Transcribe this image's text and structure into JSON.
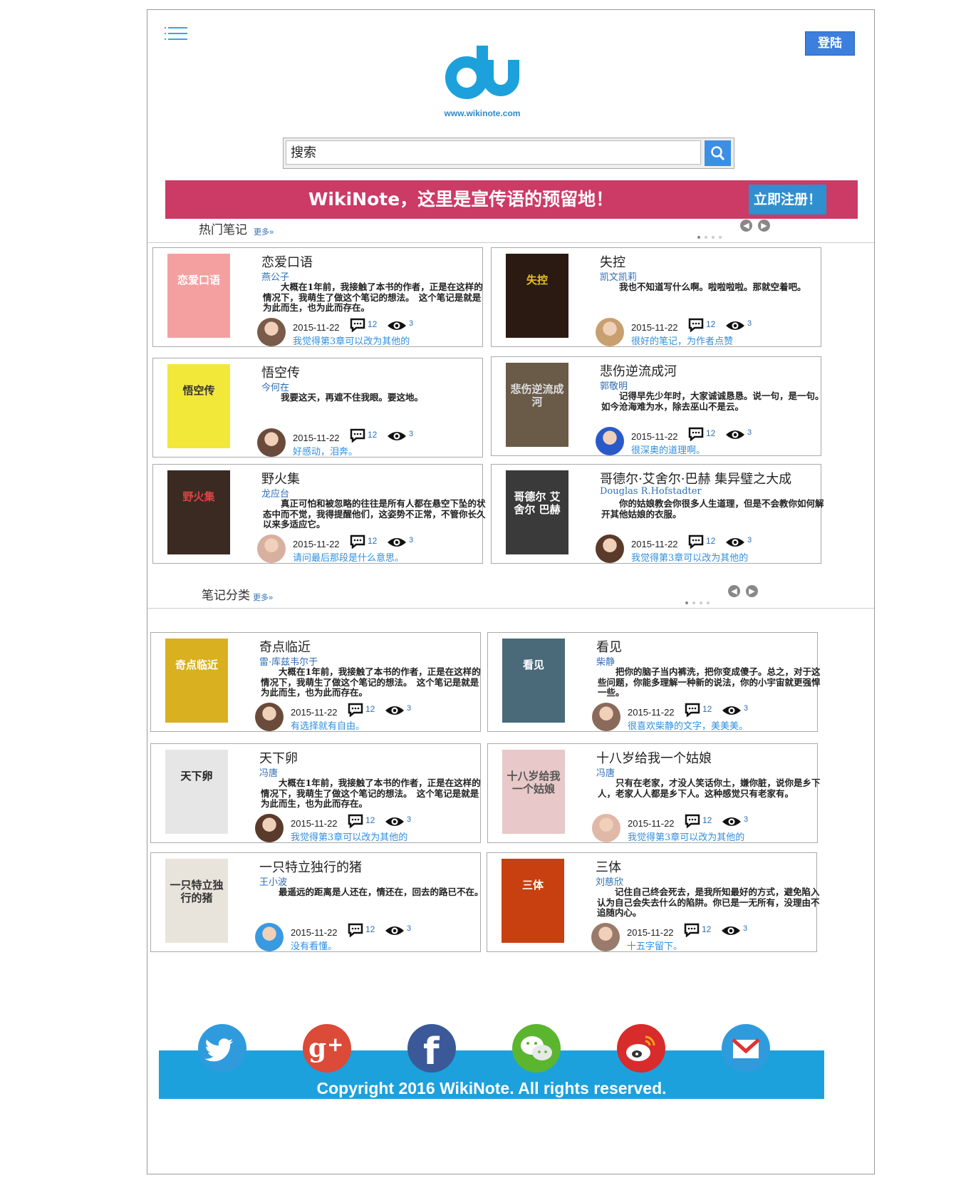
{
  "header": {
    "logo_url": "www.wikinote.com",
    "login_label": "登陆"
  },
  "search": {
    "placeholder": "搜索"
  },
  "banner": {
    "text": "WikiNote，这里是宣传语的预留地！",
    "button_label": "立即注册！"
  },
  "hot_notes": {
    "title": "热门笔记",
    "more": "更多»",
    "cards": [
      {
        "title": "恋爱口语",
        "author": "燕公子",
        "desc": "大概在1年前，我接触了本书的作者，正是在这样的情况下，我萌生了做这个笔记的想法。　这个笔记是就是为此而生，也为此而存在。",
        "date": "2015-11-22",
        "comments": "12",
        "views": "3",
        "comment": "我觉得第3章可以改为其他的"
      },
      {
        "title": "失控",
        "author": "凯文凯莉",
        "desc": "我也不知道写什么啊。啦啦啦啦。那就空着吧。",
        "date": "2015-11-22",
        "comments": "12",
        "views": "3",
        "comment": "很好的笔记，为作者点赞"
      },
      {
        "title": "悟空传",
        "author": "今何在",
        "desc": "我要这天，再遮不住我眼。要这地。",
        "date": "2015-11-22",
        "comments": "12",
        "views": "3",
        "comment": "好感动，泪奔。"
      },
      {
        "title": "悲伤逆流成河",
        "author": "郭敬明",
        "desc": "记得早先少年时，大家诚诚恳恳。说一句，是一句。如今沧海难为水，除去巫山不是云。",
        "date": "2015-11-22",
        "comments": "12",
        "views": "3",
        "comment": "很深奥的道理啊。"
      },
      {
        "title": "野火集",
        "author": "龙应台",
        "desc": "真正可怕和被忽略的往往是所有人都在悬空下坠的状态中而不觉，我得提醒他们，这姿势不正常，不管你长久以来多适应它。",
        "date": "2015-11-22",
        "comments": "12",
        "views": "3",
        "comment": "请问最后那段是什么意思。"
      },
      {
        "title": "哥德尔·艾舍尔·巴赫 集异璧之大成",
        "author": "Douglas R.Hofstadter",
        "desc": "你的姑娘教会你很多人生道理，但是不会教你如何解开其他姑娘的衣服。",
        "date": "2015-11-22",
        "comments": "12",
        "views": "3",
        "comment": "我觉得第3章可以改为其他的"
      }
    ]
  },
  "categories": {
    "title": "笔记分类",
    "more": "更多»",
    "cards": [
      {
        "title": "奇点临近",
        "author": "雷·库兹韦尔于",
        "desc": "大概在1年前，我接触了本书的作者，正是在这样的情况下，我萌生了做这个笔记的想法。　这个笔记是就是为此而生，也为此而存在。",
        "date": "2015-11-22",
        "comments": "12",
        "views": "3",
        "comment": "有选择就有自由。"
      },
      {
        "title": "看见",
        "author": "柴静",
        "desc": "把你的脑子当内裤洗，把你变成傻子。总之，对于这些问题，你能多理解一种新的说法，你的小宇宙就更强悍一些。",
        "date": "2015-11-22",
        "comments": "12",
        "views": "3",
        "comment": "很喜欢柴静的文字，美美美。"
      },
      {
        "title": "天下卵",
        "author": "冯唐",
        "desc": "大概在1年前，我接触了本书的作者，正是在这样的情况下，我萌生了做这个笔记的想法。　这个笔记是就是为此而生，也为此而存在。",
        "date": "2015-11-22",
        "comments": "12",
        "views": "3",
        "comment": "我觉得第3章可以改为其他的"
      },
      {
        "title": "十八岁给我一个姑娘",
        "author": "冯唐",
        "desc": "只有在老家，才没人笑话你土，嫌你脏，说你是乡下人，老家人人都是乡下人。这种感觉只有老家有。",
        "date": "2015-11-22",
        "comments": "12",
        "views": "3",
        "comment": "我觉得第3章可以改为其他的"
      },
      {
        "title": "一只特立独行的猪",
        "author": "王小波",
        "desc": "最遥远的距离是人还在，情还在，回去的路已不在。",
        "date": "2015-11-22",
        "comments": "12",
        "views": "3",
        "comment": "没有看懂。"
      },
      {
        "title": "三体",
        "author": "刘慈欣",
        "desc": "记住自己终会死去，是我所知最好的方式，避免陷入认为自己会失去什么的陷阱。你已是一无所有，没理由不追随内心。",
        "date": "2015-11-22",
        "comments": "12",
        "views": "3",
        "comment": "十五字留下。"
      }
    ]
  },
  "covers": [
    "恋爱口语",
    "失控",
    "悟空传",
    "悲伤逆流成河",
    "野火集",
    "哥德尔 艾舍尔 巴赫",
    "奇点临近",
    "看见",
    "天下卵",
    "十八岁给我一个姑娘",
    "一只特立独行的猪",
    "三体"
  ],
  "colors": {
    "accent": "#1ca1dc",
    "banner": "#cc3a66",
    "link": "#2f6fb5",
    "login": "#3d7fdc"
  },
  "social": [
    "twitter-icon",
    "google-plus-icon",
    "facebook-icon",
    "wechat-icon",
    "weibo-icon",
    "mail-icon"
  ],
  "footer": {
    "copyright": "Copyright 2016 WikiNote. All rights reserved."
  }
}
